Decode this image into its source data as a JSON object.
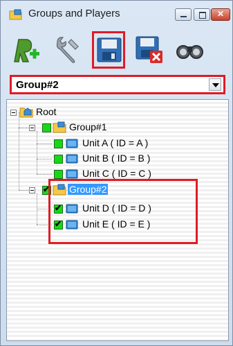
{
  "window": {
    "title": "Groups and Players"
  },
  "toolbar": {
    "buttons": [
      {
        "name": "add-player",
        "icon": "add-player-icon"
      },
      {
        "name": "settings",
        "icon": "wrench-icon"
      },
      {
        "name": "save",
        "icon": "floppy-disk-icon",
        "highlighted": true
      },
      {
        "name": "delete",
        "icon": "floppy-delete-icon"
      },
      {
        "name": "find",
        "icon": "binoculars-icon"
      }
    ]
  },
  "group_select": {
    "value": "Group#2"
  },
  "tree": {
    "root": {
      "label": "Root"
    },
    "group1": {
      "label": "Group#1",
      "units": [
        "Unit A ( ID = A )",
        "Unit B ( ID = B )",
        "Unit C ( ID = C )"
      ]
    },
    "group2": {
      "label": "Group#2",
      "selected": true,
      "units": [
        "Unit D ( ID = D )",
        "Unit E ( ID = E )"
      ]
    }
  },
  "colors": {
    "highlight": "#e01b24",
    "selection": "#3399ff",
    "checkbox": "#17d817"
  }
}
